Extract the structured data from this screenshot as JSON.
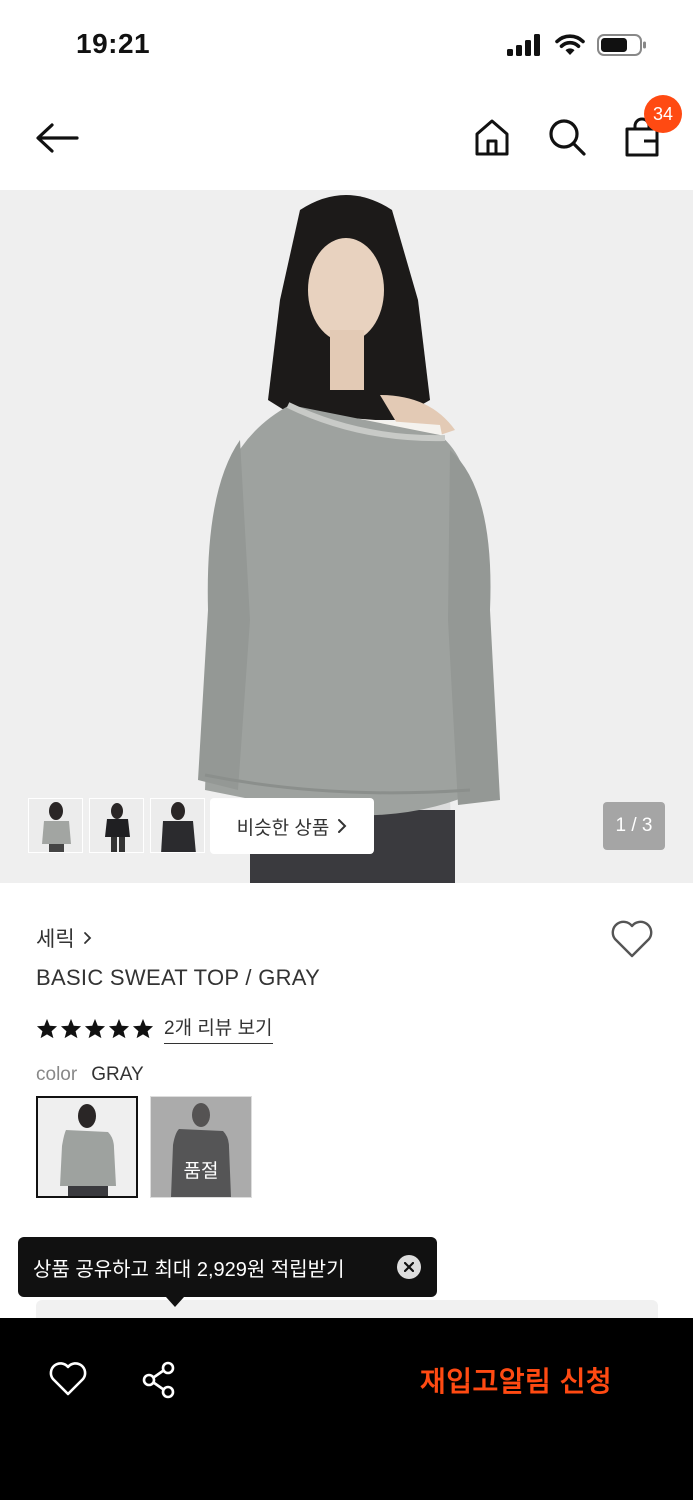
{
  "status_bar": {
    "time": "19:21"
  },
  "header": {
    "cart_count": "34"
  },
  "hero": {
    "similar_label": "비슷한 상품",
    "page_indicator": "1 / 3"
  },
  "product": {
    "brand": "세릭",
    "title": "BASIC SWEAT TOP / GRAY",
    "rating": 5,
    "review_link": "2개 리뷰 보기",
    "color_label": "color",
    "color_value": "GRAY",
    "soldout_label": "품절"
  },
  "tooltip": {
    "text": "상품 공유하고 최대 2,929원 적립받기"
  },
  "bottom_bar": {
    "restock_label": "재입고알림 신청"
  },
  "colors": {
    "accent": "#ff4a12",
    "bottom_bar_bg": "#000000"
  }
}
